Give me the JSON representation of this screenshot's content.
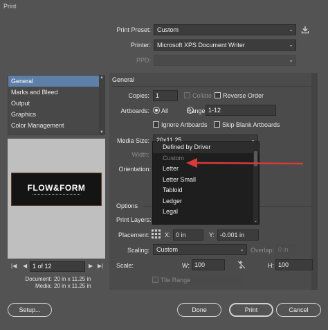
{
  "window": {
    "title": "Print"
  },
  "top": {
    "preset_label": "Print Preset:",
    "preset_value": "Custom",
    "printer_label": "Printer:",
    "printer_value": "Microsoft XPS Document Writer",
    "ppd_label": "PPD:"
  },
  "sidebar": {
    "items": [
      {
        "label": "General",
        "active": true
      },
      {
        "label": "Marks and Bleed"
      },
      {
        "label": "Output"
      },
      {
        "label": "Graphics"
      },
      {
        "label": "Color Management"
      }
    ]
  },
  "preview": {
    "logo_text": "FLOW&FORM",
    "page_value": "1 of 12",
    "document_label": "Document:",
    "document_value": "20 in x 11.25 in",
    "media_label": "Media:",
    "media_value": "20 in x 11.25 in"
  },
  "general": {
    "heading": "General",
    "copies_label": "Copies:",
    "copies_value": "1",
    "collate_label": "Collate",
    "reverse_label": "Reverse Order",
    "artboards_label": "Artboards:",
    "all_label": "All",
    "range_label": "Range:",
    "range_value": "1-12",
    "ignore_label": "Ignore Artboards",
    "skip_label": "Skip Blank Artboards"
  },
  "media": {
    "size_label": "Media Size:",
    "size_value": "20x11.25",
    "width_label": "Width:",
    "orientation_label": "Orientation:",
    "dropdown_items": [
      {
        "label": "Defined by Driver",
        "state": "selected"
      },
      {
        "label": "Custom",
        "state": "disabled"
      },
      {
        "label": "Letter"
      },
      {
        "label": "Letter Small"
      },
      {
        "label": "Tabloid"
      },
      {
        "label": "Ledger"
      },
      {
        "label": "Legal"
      }
    ]
  },
  "options": {
    "heading": "Options",
    "print_layers_label": "Print Layers:",
    "placement_label": "Placement:",
    "x_label": "X:",
    "x_value": "0 in",
    "y_label": "Y:",
    "y_value": "-0.001 in",
    "scaling_label": "Scaling:",
    "scaling_value": "Custom",
    "overlap_label": "Overlap:",
    "overlap_value": "0 in",
    "scale_label": "Scale:",
    "w_label": "W:",
    "w_value": "100",
    "h_label": "H:",
    "h_value": "100",
    "tile_label": "Tile Range:"
  },
  "footer": {
    "setup_label": "Setup...",
    "done_label": "Done",
    "print_label": "Print",
    "cancel_label": "Cancel"
  },
  "colors": {
    "arrow": "#d63a3a",
    "accent": "#5e7fa8"
  }
}
